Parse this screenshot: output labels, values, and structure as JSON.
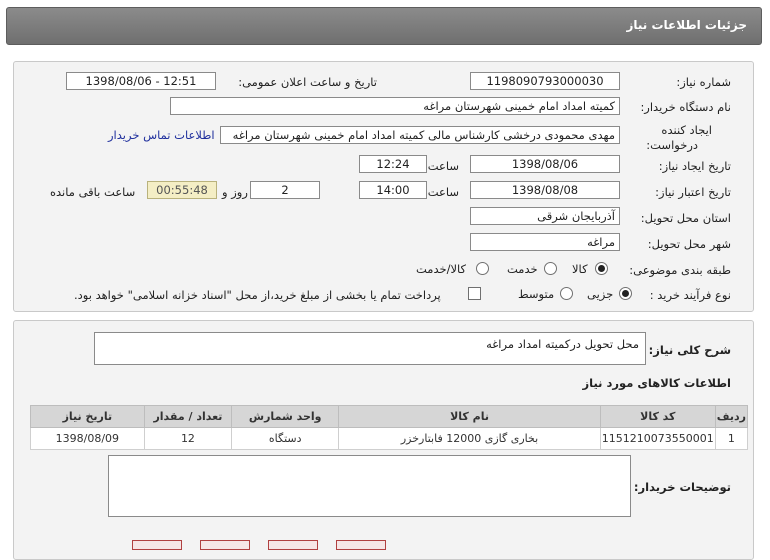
{
  "header": {
    "title": "جزئیات اطلاعات نیاز"
  },
  "info": {
    "need_number_label": "شماره نیاز:",
    "need_number": "1198090793000030",
    "announce_label": "تاریخ و ساعت اعلان عمومی:",
    "announce_value": "1398/08/06 - 12:51",
    "buyer_org_label": "نام دستگاه خریدار:",
    "buyer_org": "کمیته امداد امام خمینی شهرستان مراغه",
    "creator_label_1": "ایجاد کننده",
    "creator_label_2": "درخواست:",
    "creator": "مهدی محمودی درخشی کارشناس مالی کمیته امداد امام خمینی شهرستان مراغه",
    "contact_link": "اطلاعات تماس خریدار",
    "created_date_label": "تاریخ ایجاد نیاز:",
    "created_date": "1398/08/06",
    "time_label": "ساعت",
    "created_time": "12:24",
    "validity_label": "تاریخ اعتبار نیاز:",
    "validity_date": "1398/08/08",
    "validity_time": "14:00",
    "days": "2",
    "days_label": "روز و",
    "remaining_time": "00:55:48",
    "remaining_label": "ساعت باقی مانده",
    "province_label": "استان محل تحویل:",
    "province": "آذربایجان شرقی",
    "city_label": "شهر محل تحویل:",
    "city": "مراغه",
    "category_label": "طبقه بندی موضوعی:",
    "category_options": [
      "کالا",
      "خدمت",
      "کالا/خدمت"
    ],
    "process_label": "نوع فرآیند خرید :",
    "process_options": [
      "جزیی",
      "متوسط"
    ],
    "payment_note": "پرداخت تمام یا بخشی از مبلغ خرید،از محل \"اسناد خزانه اسلامی\" خواهد بود."
  },
  "description": {
    "label": "شرح کلی نیاز:",
    "value": "محل تحویل درکمیته امداد مراغه"
  },
  "goods": {
    "title": "اطلاعات کالاهای مورد نیاز",
    "columns": [
      "ردیف",
      "کد کالا",
      "نام کالا",
      "واحد شمارش",
      "تعداد / مقدار",
      "تاریخ نیاز"
    ],
    "rows": [
      [
        "1",
        "1151210073550001",
        "بخاری گازی 12000 فابتارخزر",
        "دستگاه",
        "12",
        "1398/08/09"
      ]
    ]
  },
  "buyer_notes": {
    "label": "توضیحات خریدار:",
    "value": ""
  }
}
